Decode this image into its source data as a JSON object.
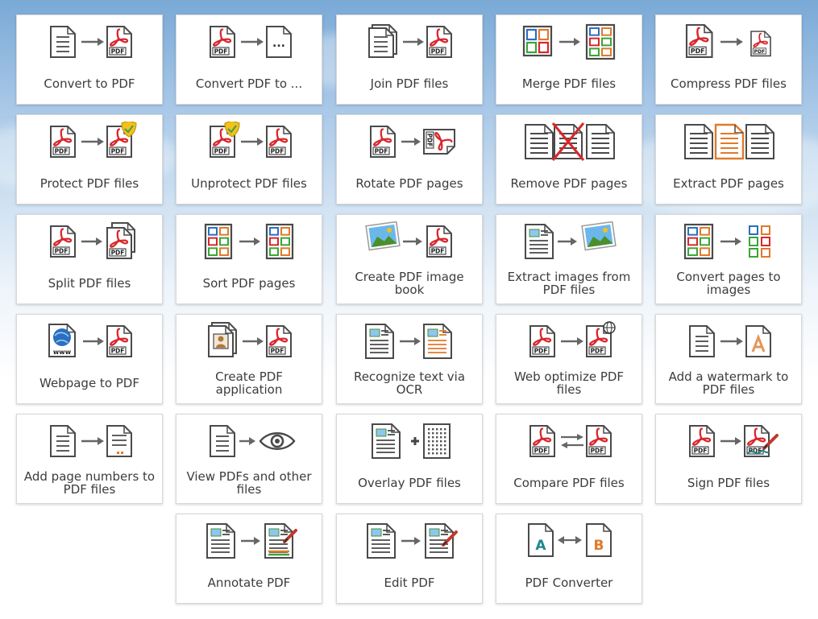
{
  "colors": {
    "pdf_red": "#d9262c",
    "icon_gray": "#4a4a4a",
    "green": "#3aa53a",
    "orange": "#e07a2a",
    "blue": "#2a6fc0",
    "yellow": "#f2c21b",
    "check_green": "#4aa04a",
    "teal": "#20888a"
  },
  "tools": [
    {
      "label": "Convert to PDF",
      "icon": "doc-to-pdf-icon"
    },
    {
      "label": "Convert PDF to ...",
      "icon": "pdf-to-format-icon"
    },
    {
      "label": "Join PDF files",
      "icon": "join-pdf-icon"
    },
    {
      "label": "Merge PDF files",
      "icon": "merge-pdf-icon"
    },
    {
      "label": "Compress PDF files",
      "icon": "compress-pdf-icon"
    },
    {
      "label": "Protect PDF files",
      "icon": "protect-pdf-icon"
    },
    {
      "label": "Unprotect PDF files",
      "icon": "unprotect-pdf-icon"
    },
    {
      "label": "Rotate PDF pages",
      "icon": "rotate-pdf-icon"
    },
    {
      "label": "Remove PDF pages",
      "icon": "remove-pages-icon"
    },
    {
      "label": "Extract PDF pages",
      "icon": "extract-pages-icon"
    },
    {
      "label": "Split PDF files",
      "icon": "split-pdf-icon"
    },
    {
      "label": "Sort PDF pages",
      "icon": "sort-pages-icon"
    },
    {
      "label": "Create PDF image book",
      "icon": "image-book-icon"
    },
    {
      "label": "Extract images from PDF files",
      "icon": "extract-images-icon"
    },
    {
      "label": "Convert pages to images",
      "icon": "pages-to-images-icon"
    },
    {
      "label": "Webpage to PDF",
      "icon": "webpage-to-pdf-icon"
    },
    {
      "label": "Create PDF application",
      "icon": "pdf-application-icon"
    },
    {
      "label": "Recognize text via OCR",
      "icon": "ocr-icon"
    },
    {
      "label": "Web optimize PDF files",
      "icon": "web-optimize-icon"
    },
    {
      "label": "Add a watermark to PDF files",
      "icon": "watermark-icon"
    },
    {
      "label": "Add page numbers to PDF files",
      "icon": "page-numbers-icon"
    },
    {
      "label": "View PDFs and other files",
      "icon": "view-files-icon"
    },
    {
      "label": "Overlay PDF files",
      "icon": "overlay-pdf-icon"
    },
    {
      "label": "Compare PDF files",
      "icon": "compare-pdf-icon"
    },
    {
      "label": "Sign PDF files",
      "icon": "sign-pdf-icon"
    },
    {
      "label": "Annotate PDF",
      "icon": "annotate-pdf-icon"
    },
    {
      "label": "Edit PDF",
      "icon": "edit-pdf-icon"
    },
    {
      "label": "PDF Converter",
      "icon": "pdf-converter-icon"
    }
  ],
  "pdf_badge": "PDF",
  "www_badge": "www",
  "converter_letters": [
    "A",
    "B"
  ]
}
